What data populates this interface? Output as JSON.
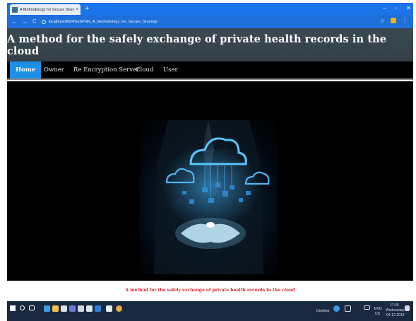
{
  "browser": {
    "tab_title": "A Methodology for Secure Shari",
    "tab_close": "×",
    "new_tab": "+",
    "nav_back": "←",
    "nav_forward": "→",
    "nav_reload": "C",
    "address_host": "localhost",
    "address_path": ":8084/SeSPHR_A_Methodology_for_Secure_Sharing/",
    "win_min": "–",
    "win_max": "▫",
    "win_close": "✕",
    "star": "☆",
    "menu": "⋮"
  },
  "page": {
    "title": "A method for the safely exchange of private health records in the cloud",
    "footer_text": "A method for the safely exchange of private health records in the cloud"
  },
  "nav": {
    "items": [
      {
        "label": "Home",
        "active": true
      },
      {
        "label": "Owner",
        "active": false
      },
      {
        "label": "Re Encryption Server",
        "active": false
      },
      {
        "label": "Cloud",
        "active": false
      },
      {
        "label": "User",
        "active": false
      }
    ]
  },
  "taskbar": {
    "desktop_label": "Desktop",
    "lang_top": "ENG",
    "lang_bottom": "US",
    "time": "17:36",
    "day": "Wednesday",
    "date": "04-12-2019"
  },
  "colors": {
    "chrome_blue": "#1a73e8",
    "header_bg": "#3a4a52",
    "nav_active": "#1e90e6",
    "footer_red": "#d9262b",
    "taskbar_bg": "#1b2940"
  }
}
